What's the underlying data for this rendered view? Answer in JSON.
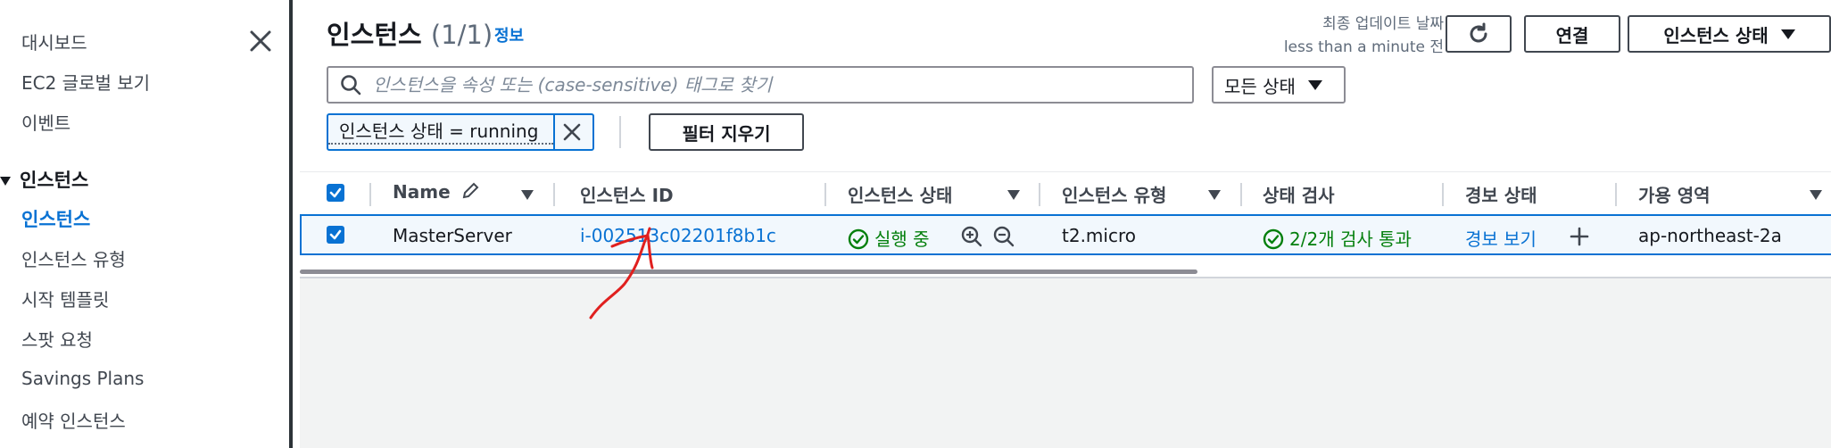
{
  "sidebar": {
    "items_top": [
      {
        "label": "대시보드"
      },
      {
        "label": "EC2 글로벌 보기"
      },
      {
        "label": "이벤트"
      }
    ],
    "section_label": "인스턴스",
    "section_items": [
      {
        "label": "인스턴스",
        "active": true
      },
      {
        "label": "인스턴스 유형"
      },
      {
        "label": "시작 템플릿"
      },
      {
        "label": "스팟 요청"
      },
      {
        "label": "Savings Plans"
      },
      {
        "label": "예약 인스턴스"
      }
    ],
    "close_icon": "close-icon"
  },
  "header": {
    "title": "인스턴스",
    "count": "(1/1)",
    "info_link": "정보",
    "updated_line1": "최종 업데이트 날짜",
    "updated_line2": "less than a minute 전",
    "refresh_icon": "refresh-icon",
    "connect_label": "연결",
    "instance_state_label": "인스턴스 상태"
  },
  "search": {
    "placeholder": "인스턴스을 속성 또는 (case-sensitive) 태그로 찾기",
    "state_filter": "모든 상태"
  },
  "filter_token": {
    "text": "인스턴스 상태 = running"
  },
  "clear_filters_label": "필터 지우기",
  "table": {
    "columns": [
      "Name",
      "인스턴스 ID",
      "인스턴스 상태",
      "인스턴스 유형",
      "상태 검사",
      "경보 상태",
      "가용 영역"
    ],
    "rows": [
      {
        "name": "MasterServer",
        "instance_id": "i-002513c02201f8b1c",
        "state": "실행 중",
        "type": "t2.micro",
        "status_check": "2/2개 검사 통과",
        "alarm": "경보 보기",
        "az": "ap-northeast-2a",
        "selected": true
      }
    ]
  },
  "colors": {
    "link": "#0972d3",
    "success": "#037f0c",
    "annotation": "#e0201f"
  }
}
